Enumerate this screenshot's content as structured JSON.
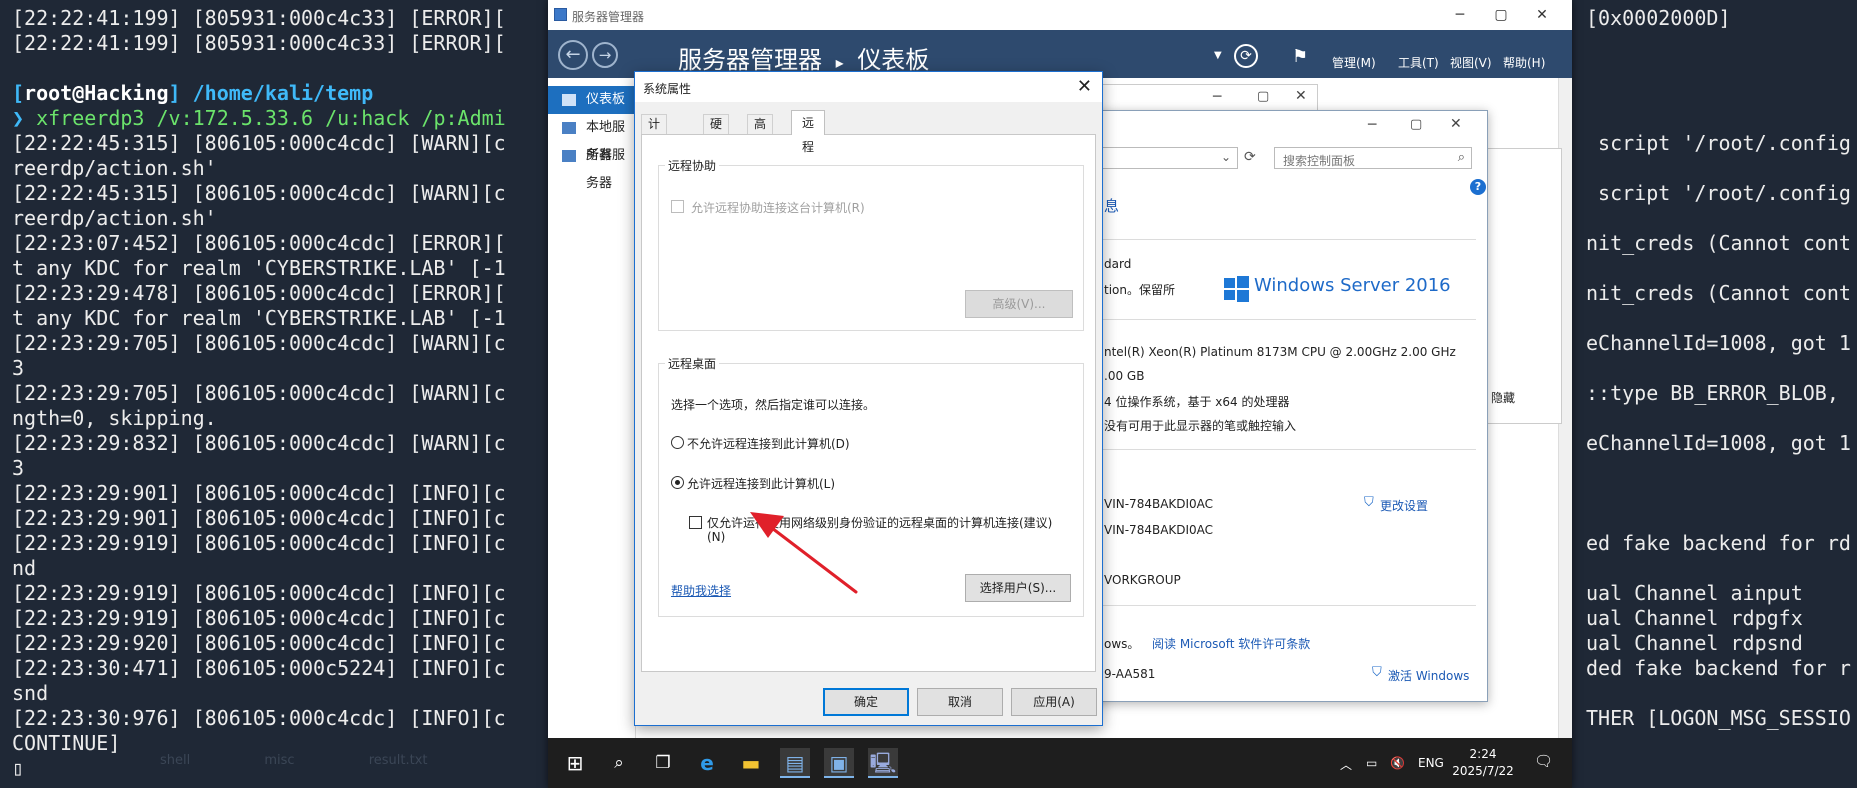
{
  "terminal": {
    "left_lines": [
      "[22:22:41:199] [805931:000c4c33] [ERROR][",
      "[22:22:41:199] [805931:000c4c33] [ERROR][",
      "",
      "__PROMPT__",
      "__CMD__",
      "[22:22:45:315] [806105:000c4cdc] [WARN][c",
      "reerdp/action.sh'",
      "[22:22:45:315] [806105:000c4cdc] [WARN][c",
      "reerdp/action.sh'",
      "[22:23:07:452] [806105:000c4cdc] [ERROR][",
      "t any KDC for realm 'CYBERSTRIKE.LAB' [-1",
      "[22:23:29:478] [806105:000c4cdc] [ERROR][",
      "t any KDC for realm 'CYBERSTRIKE.LAB' [-1",
      "[22:23:29:705] [806105:000c4cdc] [WARN][c",
      "3",
      "[22:23:29:705] [806105:000c4cdc] [WARN][c",
      "ngth=0, skipping.",
      "[22:23:29:832] [806105:000c4cdc] [WARN][c",
      "3",
      "[22:23:29:901] [806105:000c4cdc] [INFO][c",
      "[22:23:29:901] [806105:000c4cdc] [INFO][c",
      "[22:23:29:919] [806105:000c4cdc] [INFO][c",
      "nd",
      "[22:23:29:919] [806105:000c4cdc] [INFO][c",
      "[22:23:29:919] [806105:000c4cdc] [INFO][c",
      "[22:23:29:920] [806105:000c4cdc] [INFO][c",
      "[22:23:30:471] [806105:000c5224] [INFO][c",
      "snd",
      "[22:23:30:976] [806105:000c4cdc] [INFO][c",
      "CONTINUE]",
      "▯"
    ],
    "prompt": {
      "user": "root@Hacking",
      "path": "/home/kali/temp"
    },
    "command": {
      "arrow": "❯",
      "text": " xfreerdp3 /v:172.5.33.6 /u:hack /p:Admi"
    },
    "right_lines": [
      "[0x0002000D]",
      "",
      "",
      "",
      "",
      " script '/root/.config",
      "",
      " script '/root/.config",
      "",
      "nit_creds (Cannot cont",
      "",
      "nit_creds (Cannot cont",
      "",
      "eChannelId=1008, got 1",
      "",
      "::type BB_ERROR_BLOB, ",
      "",
      "eChannelId=1008, got 1",
      "",
      "",
      "",
      "ed fake backend for rd",
      "",
      "ual Channel ainput",
      "ual Channel rdpgfx",
      "ual Channel rdpsnd",
      "ded fake backend for r",
      "",
      "THER [LOGON_MSG_SESSIO"
    ],
    "bg_tabs": [
      "shell",
      "misc",
      "result.txt"
    ]
  },
  "rdp": {
    "title": "服务器管理器",
    "min": "─",
    "max": "▢",
    "close": "✕"
  },
  "server_manager": {
    "crumb_root": "服务器管理器",
    "crumb_sep": "▸",
    "crumb_page": "仪表板",
    "menus": [
      "管理(M)",
      "工具(T)",
      "视图(V)",
      "帮助(H)"
    ],
    "nav_items": [
      "仪表板",
      "本地服务器",
      "所有服务器"
    ]
  },
  "control_panel": {
    "search_placeholder": "搜索控制面板",
    "heading": "息",
    "edition_1": "dard",
    "edition_2": "tion。保留所",
    "product": "Windows Server 2016",
    "cpu": "ntel(R) Xeon(R) Platinum 8173M CPU @ 2.00GHz   2.00 GHz",
    "ram": ".00 GB",
    "systype": "4 位操作系统，基于 x64 的处理器",
    "pen": "没有可用于此显示器的笔或触控输入",
    "hidden": "隐藏",
    "pc_name": "VIN-784BAKDI0AC",
    "pc_full": "VIN-784BAKDI0AC",
    "workgroup": "VORKGROUP",
    "change_settings": "更改设置",
    "license_prefix": "ows。",
    "license_link": "阅读 Microsoft 软件许可条款",
    "product_id": "9-AA581",
    "activate": "激活 Windows"
  },
  "dialog": {
    "title": "系统属性",
    "close": "✕",
    "tabs": [
      "计算机名",
      "硬件",
      "高级",
      "远程"
    ],
    "remote_assist": {
      "group": "远程协助",
      "checkbox": "允许远程协助连接这台计算机(R)",
      "advanced": "高级(V)..."
    },
    "remote_desktop": {
      "group": "远程桌面",
      "instruction": "选择一个选项，然后指定谁可以连接。",
      "opt_deny": "不允许远程连接到此计算机(D)",
      "opt_allow": "允许远程连接到此计算机(L)",
      "nla_line1": "仅允许运行使用网络级别身份验证的远程桌面的计算机连接(建议)",
      "nla_line2": "(N)",
      "help_link": "帮助我选择",
      "select_users": "选择用户(S)..."
    },
    "ok": "确定",
    "cancel": "取消",
    "apply": "应用(A)"
  },
  "taskbar": {
    "lang": "ENG",
    "time": "2:24",
    "date": "2025/7/22"
  },
  "colors": {
    "terminal_bg": "#1f2836",
    "prompt_blue": "#3fb9f8",
    "cmd_green": "#6be36b",
    "sm_header": "#2e4a6e",
    "arrow_red": "#e0202a"
  }
}
